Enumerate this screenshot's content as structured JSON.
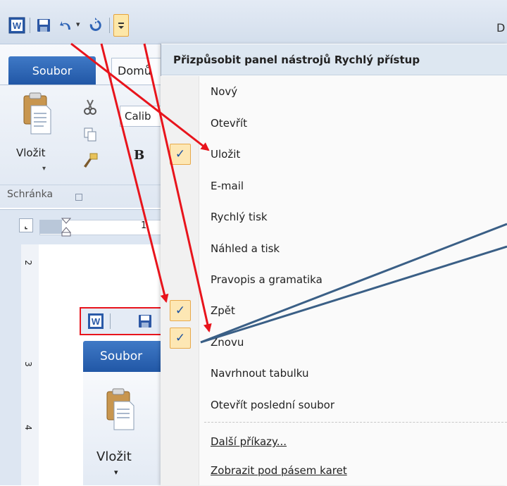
{
  "titlebar": {
    "title_fragment": "D"
  },
  "ribbon": {
    "tab_file": "Soubor",
    "tab_home": "Domů",
    "paste_label": "Vložit",
    "font_name": "Calib",
    "bold_label": "B",
    "clipboard_group": "Schránka"
  },
  "ruler": {
    "mark_1": "1",
    "v_marks": [
      "2",
      "3",
      "4"
    ]
  },
  "inner": {
    "tab_file": "Soubor",
    "paste_label": "Vložit"
  },
  "menu": {
    "header": "Přizpůsobit panel nástrojů Rychlý přístup",
    "items": [
      {
        "label": "Nový",
        "checked": false
      },
      {
        "label": "Otevřít",
        "checked": false
      },
      {
        "label": "Uložit",
        "checked": true
      },
      {
        "label": "E-mail",
        "checked": false
      },
      {
        "label": "Rychlý tisk",
        "checked": false
      },
      {
        "label": "Náhled a tisk",
        "checked": false
      },
      {
        "label": "Pravopis a gramatika",
        "checked": false
      },
      {
        "label": "Zpět",
        "checked": true
      },
      {
        "label": "Znovu",
        "checked": true
      },
      {
        "label": "Navrhnout tabulku",
        "checked": false
      },
      {
        "label": "Otevřít poslední soubor",
        "checked": false
      }
    ],
    "more_commands": "Další příkazy...",
    "show_below": "Zobrazit pod pásem karet",
    "check_glyph": "✓"
  },
  "colors": {
    "arrow_red": "#e8141c",
    "arrow_blue": "#3a5f86",
    "highlight_box": "#e8141c"
  }
}
